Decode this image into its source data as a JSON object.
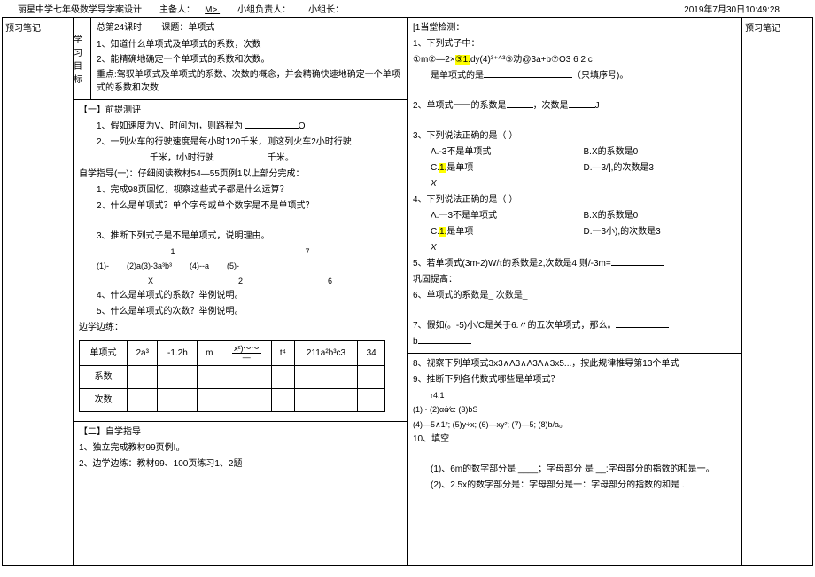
{
  "header": {
    "school": "丽星中学七年级数学导学案设计",
    "host_label": "主备人：",
    "host_value": "M>.",
    "group_leader_label": "小组负责人：",
    "group_label": "小组长：",
    "timestamp": "2019年7月30日10:49:28"
  },
  "notes_left": "预习笔记",
  "notes_right": "预习笔记",
  "top": {
    "lesson_no": "总第24课时",
    "lesson_title": "课题：单项式",
    "goal_label": "学习目标",
    "goal1": "1、知道什么单项式及单项式的系数，次数",
    "goal2": "2、能精确地确定一个单项式的系数和次数。",
    "keypoint": "重点:驾驭单项式及单项式的系数、次数的概念，并会精确快速地确定一个单项式的系数和次数"
  },
  "left": {
    "sec1_title": "【一】前提测评",
    "sec1_q1": "1、假如速度为V、时间为t，则路程为",
    "sec1_q1_suffix": "O",
    "sec1_q2a": "2、一列火车的行驶速度是每小时120千米，则这列火车2小时行驶",
    "sec1_q2b": "千米，t小时行驶",
    "sec1_q2c": "千米。",
    "guide1": "自学指导(一)：仔细阅读教材54—55页例1以上部分完成：",
    "g1_q1": "1、完成98页回忆，视察这些式子都是什么运算？",
    "g1_q2": "2、什么是单项式？单个字母或单个数字是不是单项式？",
    "g1_q3": "3、推断下列式子是不是单项式，说明理由。",
    "expr_labels": {
      "a": "1",
      "b": "7",
      "c": "(1)-",
      "d": "(2)a(3)-3a³b³",
      "e": "(4)--a",
      "f": "(5)-",
      "g": "2",
      "h": "6",
      "i": "X"
    },
    "g1_q4": "4、什么是单项式的系数？举例说明。",
    "g1_q5": "5、什么是单项式的次数？举例说明。",
    "bianxue": "边学边练：",
    "table": {
      "r1": "单项式",
      "c1": "2a³",
      "c2": "-1.2h",
      "c3": "m",
      "c4_top": "x²)〜〜",
      "c4_bot": "—",
      "c5": "t⁴",
      "c6": "211a²b³c3",
      "c7": "34",
      "r2": "系数",
      "r3": "次数"
    },
    "sec2_title": "【二】自学指导",
    "sec2_q1": "1、独立完成教材99页例I₀",
    "sec2_q2": "2、边学边练：教材99、100页练习1、2题"
  },
  "right": {
    "check_title": "[1当堂检测：",
    "q1a": "1、下列式子中：",
    "q1b_pre": "①m②—2×",
    "q1b_hl": "③1.",
    "q1b_post": "dy(4)³⁺^³⑤劝@3a+b⑦O3   6          2         c",
    "q1c": "是单项式的是",
    "q1d": "（只填序号)。",
    "q2": "2、单项式一一的系数是",
    "q2b": "，次数是",
    "q2c": "J",
    "q3": "3、下列说法正确的是（            ）",
    "q3a": "Λ.-3不是单项式",
    "q3b": "B.X的系数是0",
    "q3c_pre": "C.",
    "q3c_hl": "1.",
    "q3c_post": "是单项",
    "q3c_den": "X",
    "q3d": "D.—3/],的次数是3",
    "q4": "4、下列说法正确的是（            ）",
    "q4a": "Λ.一3不是单项式",
    "q4b": "B.X的系数是0",
    "q4c_pre": "C.",
    "q4c_hl": "1.",
    "q4c_post": "是单项",
    "q4c_den": "X",
    "q4d": "D.一3小),的次数是3",
    "q5": "5、若单项式(3m-2)W/τ的系数是2,次数是4,则/-3m=",
    "consolidate": "巩固提高：",
    "q6": "6、单项式的系数是_                        次数是_",
    "q7": "7、假如(。-5)小/C是关于6.〃的五次单项式，那么。",
    "q7b": "b",
    "q8a": "8、视察下列单项式3x3∧Λ3∧Λ3Λ∧3x5...，按此规律推导第13个单式",
    "q9": "9、推断下列各代数式哪些是单项式？",
    "q9_expr1": "r4.1",
    "q9_expr2": "(1)     ·     (2)αά⁄c: (3)bS",
    "q9_expr3": "(4)—5∧1²; (5)y÷x;   (6)—xy²;  (7)—5;     (8)b/a₀",
    "q10": "10、填空",
    "q10_1": "(1)、6m的数字部分是 ____；字母部分 是 __:字母部分的指数的和是一。",
    "q10_2": "(2)、2.5x的数字部分是：字母部分是一：字母部分的指数的和是    ."
  }
}
